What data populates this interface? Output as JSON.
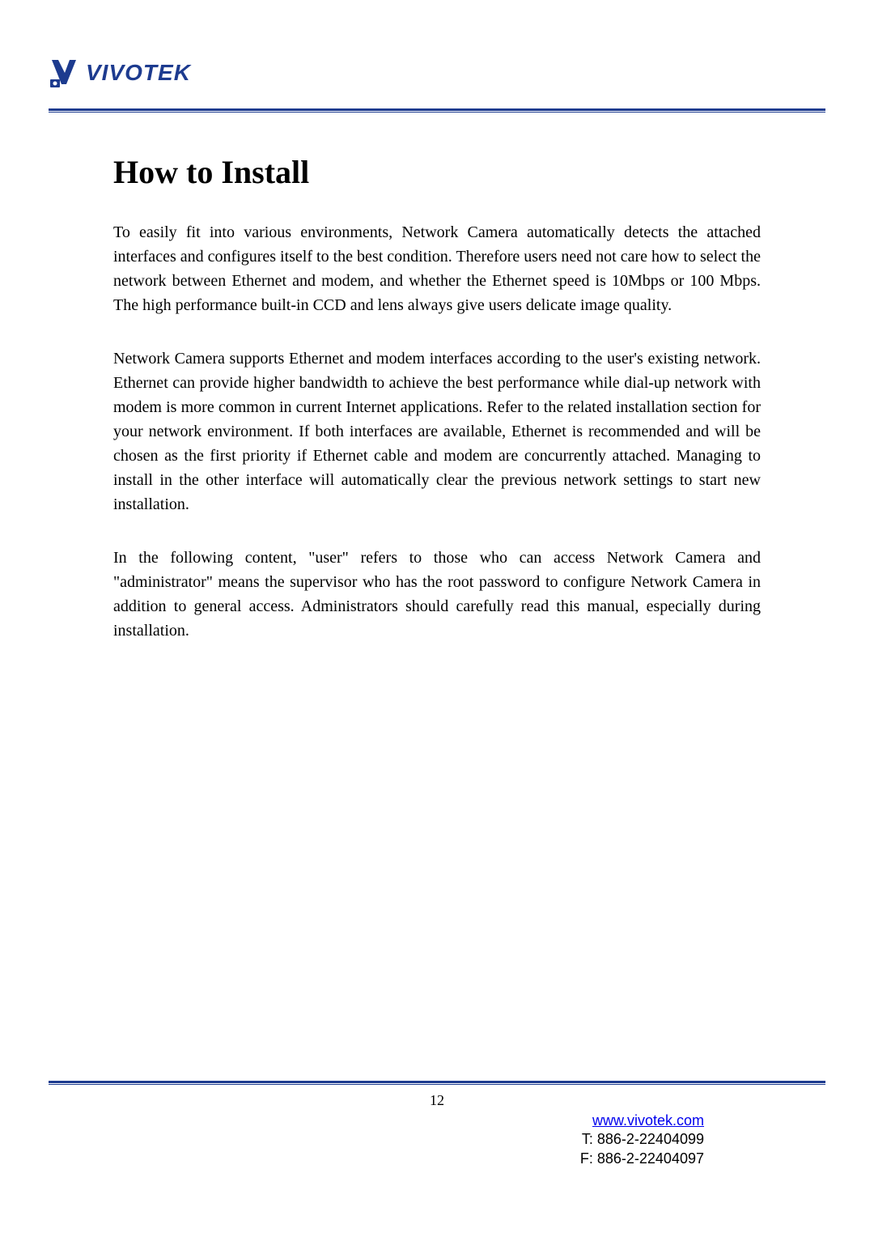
{
  "brand": {
    "name": "VIVOTEK"
  },
  "heading": "How to Install",
  "paragraphs": {
    "p1": "To easily fit into various environments, Network Camera automatically detects the attached interfaces and configures itself to the best condition. Therefore users need not care how to select the network between Ethernet and modem, and whether the Ethernet speed is 10Mbps or 100 Mbps. The high performance built-in CCD and lens always give users delicate image quality.",
    "p2": "Network Camera supports Ethernet and modem interfaces according to the user's existing network. Ethernet can provide higher bandwidth to achieve the best performance while dial-up network with modem is more common in current Internet applications. Refer to the related installation section for your network environment. If both interfaces are available, Ethernet is recommended and will be chosen as the first priority if Ethernet cable and modem are concurrently attached. Managing to install in the other interface will automatically clear the previous network settings to start new installation.",
    "p3": "In the following content, \"user\" refers to those who can access Network Camera and \"administrator\" means the supervisor who has the root password to configure Network Camera in addition to general access. Administrators should carefully read this manual, especially during installation."
  },
  "page_number": "12",
  "footer": {
    "website": "www.vivotek.com",
    "tel": "T: 886-2-22404099",
    "fax": "F: 886-2-22404097"
  }
}
